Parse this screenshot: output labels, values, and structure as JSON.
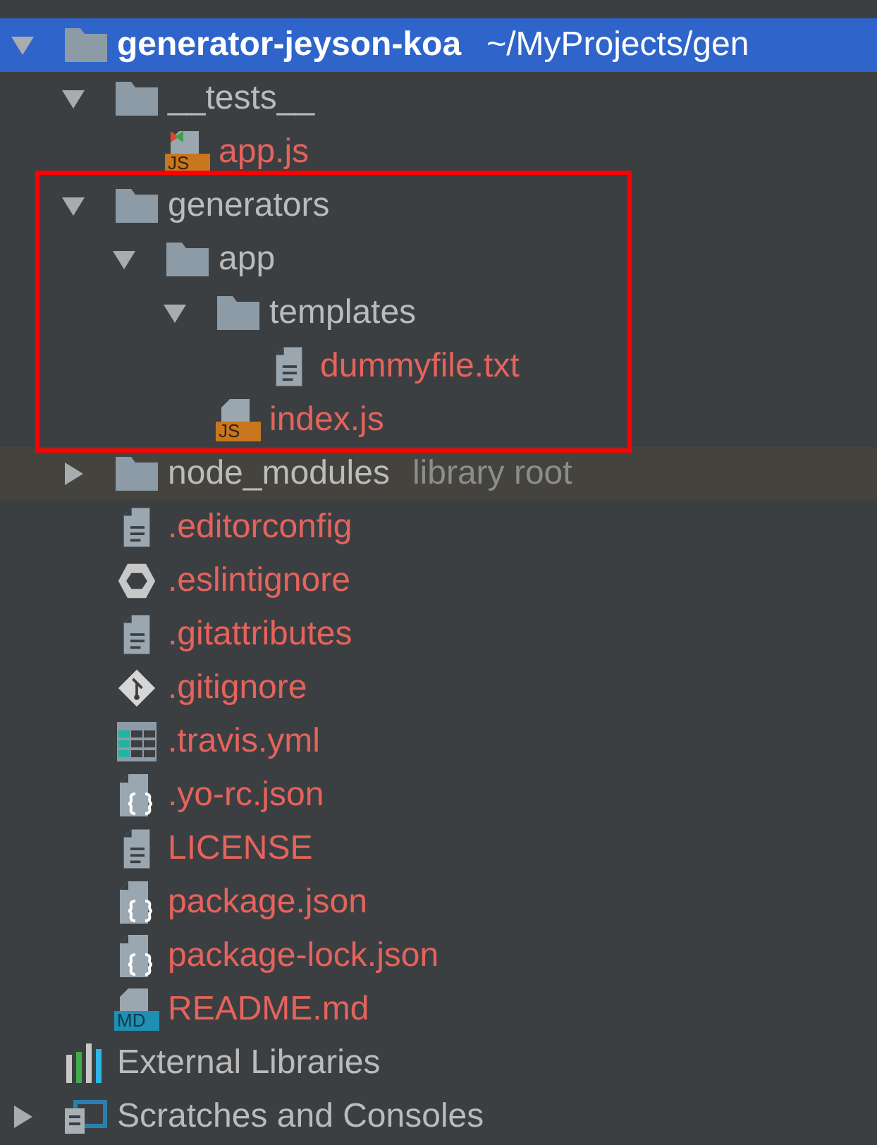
{
  "project_tree": {
    "nodes": [
      {
        "name": "generator-jeyson-koa",
        "kind": "folder",
        "bold": true,
        "path": "~/MyProjects/gen",
        "selected": true,
        "expanded": true,
        "color": "#ffffff",
        "children": [
          {
            "name": "__tests__",
            "kind": "folder",
            "selected": false,
            "expanded": true,
            "color": "#bbbbbb",
            "children": [
              {
                "name": "app.js",
                "kind": "js-test",
                "badge": "JS",
                "selected": false,
                "color": "#e5635c"
              }
            ]
          },
          {
            "name": "generators",
            "kind": "folder",
            "selected": false,
            "expanded": true,
            "highlighted": true,
            "color": "#bbbbbb",
            "children": [
              {
                "name": "app",
                "kind": "folder",
                "selected": false,
                "expanded": true,
                "color": "#bbbbbb",
                "children": [
                  {
                    "name": "templates",
                    "kind": "folder",
                    "selected": false,
                    "expanded": true,
                    "color": "#bbbbbb",
                    "children": [
                      {
                        "name": "dummyfile.txt",
                        "kind": "text",
                        "selected": false,
                        "color": "#e5635c"
                      }
                    ]
                  },
                  {
                    "name": "index.js",
                    "kind": "js",
                    "badge": "JS",
                    "selected": false,
                    "color": "#e5635c"
                  }
                ]
              }
            ]
          },
          {
            "name": "node_modules",
            "kind": "folder",
            "suffix": "library root",
            "excluded": true,
            "selected": false,
            "expanded": false,
            "color": "#bbbbbb"
          },
          {
            "name": ".editorconfig",
            "kind": "text",
            "selected": false,
            "color": "#e5635c"
          },
          {
            "name": ".eslintignore",
            "kind": "eslint",
            "selected": false,
            "color": "#e5635c"
          },
          {
            "name": ".gitattributes",
            "kind": "text",
            "selected": false,
            "color": "#e5635c"
          },
          {
            "name": ".gitignore",
            "kind": "git",
            "selected": false,
            "color": "#e5635c"
          },
          {
            "name": ".travis.yml",
            "kind": "table",
            "selected": false,
            "color": "#e5635c"
          },
          {
            "name": ".yo-rc.json",
            "kind": "json",
            "selected": false,
            "color": "#e5635c"
          },
          {
            "name": "LICENSE",
            "kind": "text",
            "selected": false,
            "color": "#e5635c"
          },
          {
            "name": "package.json",
            "kind": "json",
            "selected": false,
            "color": "#e5635c"
          },
          {
            "name": "package-lock.json",
            "kind": "json",
            "selected": false,
            "color": "#e5635c"
          },
          {
            "name": "README.md",
            "kind": "md",
            "badge": "MD",
            "selected": false,
            "color": "#e5635c"
          }
        ]
      },
      {
        "name": "External Libraries",
        "kind": "libraries",
        "selected": false,
        "color": "#bbbbbb"
      },
      {
        "name": "Scratches and Consoles",
        "kind": "scratches",
        "selected": false,
        "expanded": false,
        "color": "#bbbbbb"
      }
    ]
  }
}
